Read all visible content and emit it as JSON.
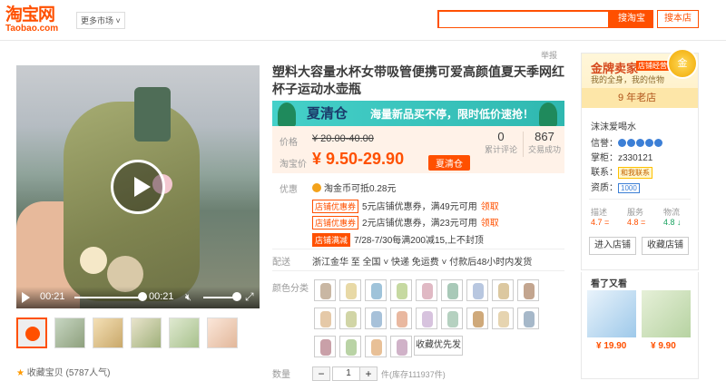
{
  "header": {
    "logo_cn": "淘宝网",
    "logo_en": "Taobao.com",
    "market": "更多市场",
    "search_placeholder": "",
    "search_btn": "搜淘宝",
    "store_btn": "搜本店"
  },
  "report": "举报",
  "video": {
    "current": "00:21",
    "duration": "00:21"
  },
  "favorite": "收藏宝贝 (5787人气)",
  "product": {
    "title": "塑料大容量水杯女带吸管便携可爱高颜值夏天季网红杯子运动水壶瓶",
    "banner_tag": "夏清仓",
    "banner_msg": "海量新品买不停，限时低价速抢！",
    "price_label": "价格",
    "old_price": "¥ 20.00-40.00",
    "sale_label": "淘宝价",
    "new_price": "¥ 9.50-29.90",
    "clear_tag": "夏清仓",
    "reviews": {
      "value": "0",
      "label": "累计评论"
    },
    "sales": {
      "value": "867",
      "label": "交易成功"
    },
    "promo_label": "优惠",
    "coin": "淘金币可抵0.28元",
    "coupons": [
      {
        "tag": "店铺优惠券",
        "text": "5元店铺优惠券，满49元可用",
        "get": "领取"
      },
      {
        "tag": "店铺优惠券",
        "text": "2元店铺优惠券，满23元可用",
        "get": "领取"
      }
    ],
    "event_tag": "店铺满减",
    "event_text": "7/28-7/30每满200减15,上不封顶",
    "ship_label": "配送",
    "ship_text": "浙江金华 至  全国 ˅   快递 免运费 ˅   付款后48小时内发货",
    "color_label": "颜色分类",
    "more_btn": "收藏优先发货",
    "qty_label": "数量",
    "qty": "1",
    "stock": "件(库存111937件)"
  },
  "seller": {
    "gold": "金牌卖家",
    "gold_tag": "店铺经营",
    "sub": "我的全身，我的信物",
    "years": "9 年老店",
    "shop_name": "沫沫爱喝水",
    "credit_label": "信誉：",
    "wangwang_label": "掌柜：",
    "wangwang": "z330121",
    "contact_label": "联系：",
    "contact_btn": "和我联系",
    "qual_label": "资质：",
    "qual_val": "1000",
    "scores": [
      {
        "label": "描述",
        "value": "4.7",
        "dir": "="
      },
      {
        "label": "服务",
        "value": "4.8",
        "dir": "="
      },
      {
        "label": "物流",
        "value": "4.8",
        "dir": "↓"
      }
    ],
    "enter_btn": "进入店铺",
    "fav_btn": "收藏店铺"
  },
  "recommend": {
    "title": "看了又看",
    "items": [
      {
        "price": "¥ 19.90"
      },
      {
        "price": "¥ 9.90"
      }
    ]
  }
}
